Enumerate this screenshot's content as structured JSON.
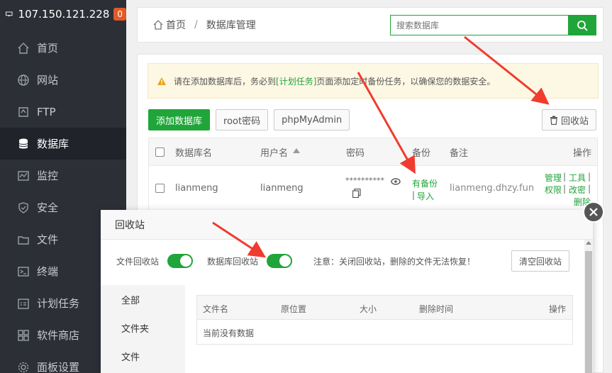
{
  "sidebar": {
    "ip": "107.150.121.228",
    "badge": "0",
    "items": [
      {
        "label": "首页",
        "icon": "home-icon"
      },
      {
        "label": "网站",
        "icon": "globe-icon"
      },
      {
        "label": "FTP",
        "icon": "ftp-icon"
      },
      {
        "label": "数据库",
        "icon": "database-icon"
      },
      {
        "label": "监控",
        "icon": "monitor-icon"
      },
      {
        "label": "安全",
        "icon": "shield-icon"
      },
      {
        "label": "文件",
        "icon": "folder-icon"
      },
      {
        "label": "终端",
        "icon": "terminal-icon"
      },
      {
        "label": "计划任务",
        "icon": "clock-icon"
      },
      {
        "label": "软件商店",
        "icon": "grid-icon"
      },
      {
        "label": "面板设置",
        "icon": "gear-icon"
      }
    ],
    "active_index": 3
  },
  "breadcrumb": {
    "home": "首页",
    "sep": "/",
    "current": "数据库管理"
  },
  "search": {
    "placeholder": "搜索数据库"
  },
  "notice": {
    "prefix": "请在添加数据库后，务必到",
    "link": "[计划任务]",
    "suffix": "页面添加定时备份任务，以确保您的数据安全。"
  },
  "toolbar": {
    "add_db": "添加数据库",
    "root_pwd": "root密码",
    "phpmyadmin": "phpMyAdmin",
    "recycle": "回收站"
  },
  "table": {
    "headers": {
      "name": "数据库名",
      "user": "用户名",
      "password": "密码",
      "backup": "备份",
      "remark": "备注",
      "ops": "操作"
    },
    "rows": [
      {
        "name": "lianmeng",
        "user": "lianmeng",
        "password": "**********",
        "backup_link": "有备份",
        "backup_sep": "|",
        "import_link": "导入",
        "remark": "lianmeng.dhzy.fun",
        "op_manage": "管理",
        "op_tools": "工具",
        "op_perm": "权限",
        "op_changepwd": "改密",
        "op_delete": "删除",
        "op_sep": "|"
      }
    ]
  },
  "modal": {
    "title": "回收站",
    "file_recycle": "文件回收站",
    "db_recycle": "数据库回收站",
    "warning": "注意：关闭回收站，删除的文件无法恢复！",
    "clear": "清空回收站",
    "tabs": [
      "全部",
      "文件夹",
      "文件"
    ],
    "headers": {
      "name": "文件名",
      "orig": "原位置",
      "size": "大小",
      "time": "删除时间",
      "ops": "操作"
    },
    "empty": "当前没有数据"
  },
  "colors": {
    "accent": "#20a53a",
    "sidebar": "#2c3036",
    "arrow": "#f03c2e"
  }
}
